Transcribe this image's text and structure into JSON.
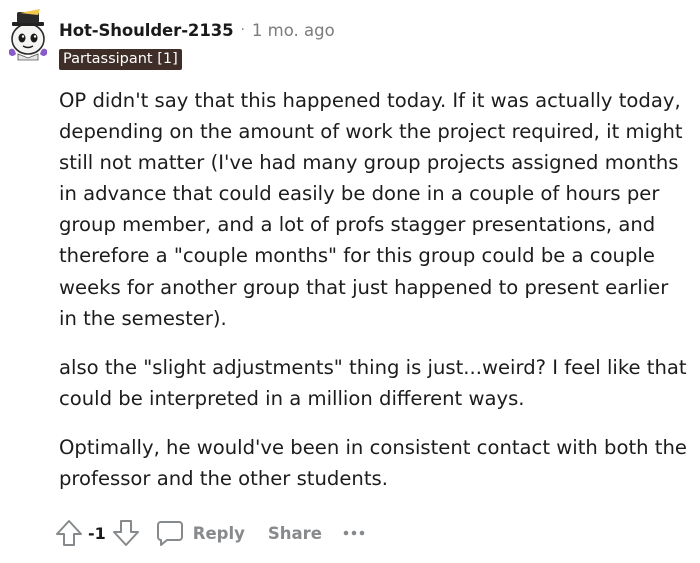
{
  "comment": {
    "author": "Hot-Shoulder-2135",
    "separator": "·",
    "time": "1 mo. ago",
    "flair": "Partassipant [1]",
    "paragraphs": [
      "OP didn't say that this happened today. If it was actually today, depending on the amount of work the project required, it might still not matter (I've had many group projects assigned months in advance that could easily be done in a couple of hours per group member, and a lot of profs stagger presentations, and therefore a \"couple months\" for this group could be a couple weeks for another group that just happened to present earlier in the semester).",
      "also the \"slight adjustments\" thing is just...weird? I feel like that could be interpreted in a million different ways.",
      "Optimally, he would've been in consistent contact with both the professor and the other students."
    ]
  },
  "actions": {
    "upvote_icon": "arrow-up-outline-icon",
    "score": "-1",
    "downvote_icon": "arrow-down-outline-icon",
    "reply_icon": "speech-bubble-icon",
    "reply_label": "Reply",
    "share_label": "Share",
    "more_icon": "horizontal-ellipsis-icon"
  },
  "colors": {
    "flair_bg": "#3f2e27",
    "muted": "#878a8c",
    "text": "#1c1c1c"
  }
}
